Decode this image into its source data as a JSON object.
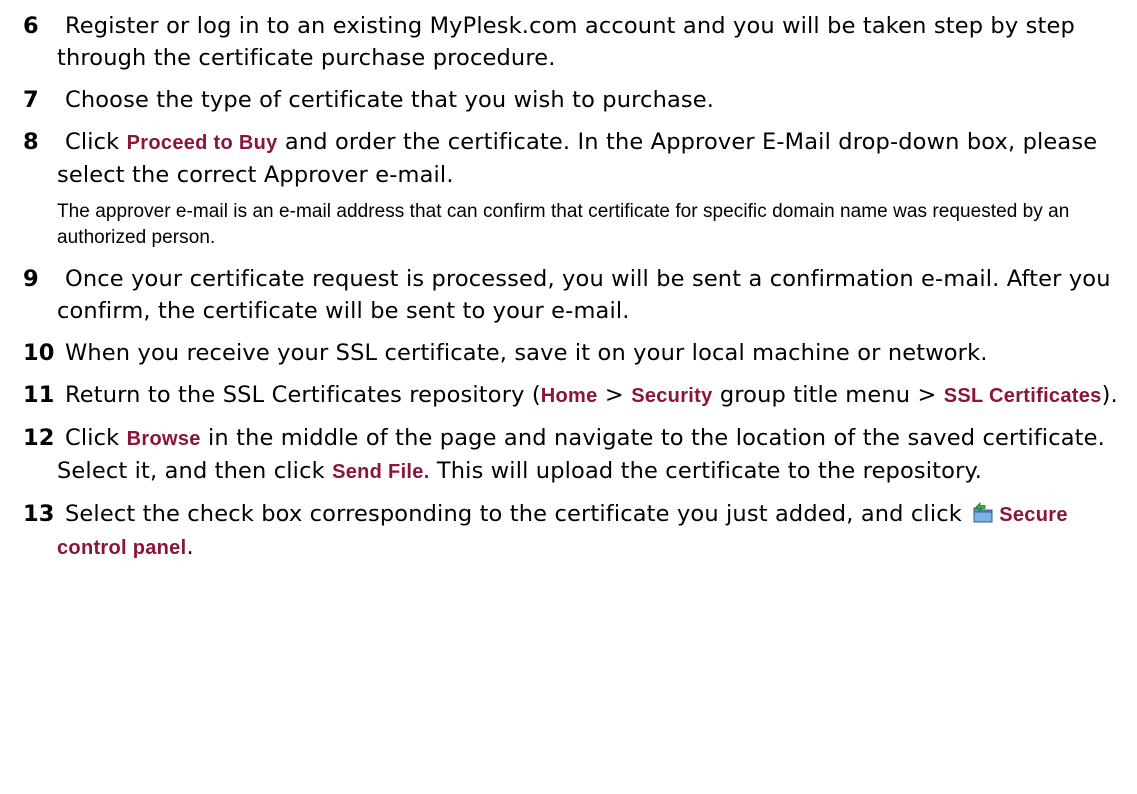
{
  "steps": [
    {
      "number": "6",
      "text": "Register or log in to an existing MyPlesk.com account and you will be taken step by step through the certificate purchase procedure."
    },
    {
      "number": "7",
      "text": "Choose the type of certificate that you wish to purchase."
    },
    {
      "number": "8",
      "pre": "Click ",
      "ui": "Proceed to Buy",
      "post": " and order the certificate. In the Approver E-Mail drop-down box, please select the correct Approver e-mail.",
      "note": "The approver e-mail is an e-mail address that can confirm that certificate for specific domain name was requested by an authorized person."
    },
    {
      "number": "9",
      "text": "Once your certificate request is processed, you will be sent a confirmation e-mail. After you confirm, the certificate will be sent to your e-mail."
    },
    {
      "number": "10",
      "text": "When you receive your SSL certificate, save it on your local machine or network."
    },
    {
      "number": "11",
      "pre": "Return to the SSL Certificates repository (",
      "ui_home": "Home",
      "sep": " > ",
      "ui_security": "Security",
      "mid": " group title menu > ",
      "ui_ssl": "SSL Certificates",
      "post": ")."
    },
    {
      "number": "12",
      "pre": "Click ",
      "ui_browse": "Browse",
      "mid": " in the middle of the page and navigate to the location of the saved certificate. Select it, and then click ",
      "ui_send": "Send File.",
      "post": " This will upload the certificate to the repository."
    },
    {
      "number": "13",
      "pre": "Select the check box corresponding to the certificate you just added, and click ",
      "icon": "secure-panel-icon",
      "ui": "Secure control panel",
      "post": "."
    }
  ],
  "colors": {
    "ui_text": "#8a1538",
    "body_text": "#000000"
  }
}
